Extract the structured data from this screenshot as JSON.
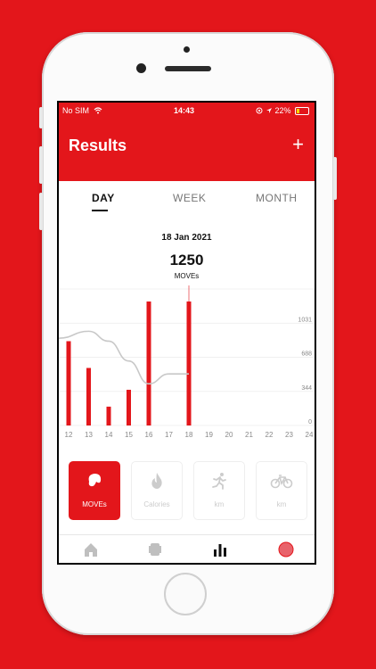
{
  "status_bar": {
    "carrier": "No SIM",
    "time": "14:43",
    "battery": "22%"
  },
  "header": {
    "title": "Results",
    "add_label": "+"
  },
  "tabs": [
    {
      "label": "DAY",
      "active": true
    },
    {
      "label": "WEEK",
      "active": false
    },
    {
      "label": "MONTH",
      "active": false
    }
  ],
  "summary": {
    "date": "18 Jan 2021",
    "total": "1250",
    "unit": "MOVEs"
  },
  "chart_data": {
    "type": "bar",
    "categories": [
      "12",
      "13",
      "14",
      "15",
      "16",
      "17",
      "18",
      "19",
      "20",
      "21",
      "22",
      "23",
      "24"
    ],
    "series": [
      {
        "type": "bar",
        "values": [
          850,
          580,
          190,
          360,
          1250,
          0,
          1250,
          0,
          0,
          0,
          0,
          0,
          0
        ]
      },
      {
        "type": "line",
        "values": [
          880,
          950,
          850,
          650,
          420,
          520,
          520
        ]
      }
    ],
    "y_ticks": [
      "0",
      "344",
      "688",
      "1031"
    ],
    "ylim": [
      0,
      1376
    ],
    "grid": true,
    "bar_color": "#e3161b",
    "line_color": "#c8c8c8"
  },
  "metrics": [
    {
      "label": "MOVEs",
      "icon": "moves-icon",
      "active": true
    },
    {
      "label": "Calories",
      "icon": "flame-icon",
      "active": false
    },
    {
      "label": "km",
      "icon": "runner-icon",
      "active": false
    },
    {
      "label": "km",
      "icon": "bike-icon",
      "active": false
    }
  ],
  "nav": [
    {
      "icon": "home-icon",
      "active": false
    },
    {
      "icon": "tracker-icon",
      "active": false
    },
    {
      "icon": "stats-icon",
      "active": true
    },
    {
      "icon": "record-icon",
      "active": false
    }
  ],
  "colors": {
    "accent": "#e3161b",
    "muted": "#cccccc"
  }
}
